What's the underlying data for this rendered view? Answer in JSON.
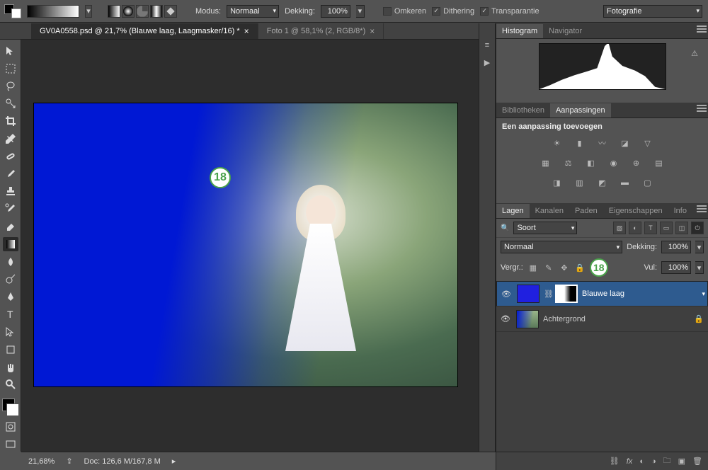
{
  "options_bar": {
    "modus_label": "Modus:",
    "modus_value": "Normaal",
    "dekking_label": "Dekking:",
    "dekking_value": "100%",
    "omkeren_label": "Omkeren",
    "omkeren_checked": false,
    "dithering_label": "Dithering",
    "dithering_checked": true,
    "transparantie_label": "Transparantie",
    "transparantie_checked": true,
    "workspace": "Fotografie"
  },
  "tabs": [
    {
      "label": "GV0A0558.psd @ 21,7% (Blauwe laag, Laagmasker/16) *",
      "active": true
    },
    {
      "label": "Foto 1 @ 58,1% (2, RGB/8*)",
      "active": false
    }
  ],
  "callout_a": "18",
  "callout_b": "18",
  "panels": {
    "histogram_tab": "Histogram",
    "navigator_tab": "Navigator",
    "bibliotheken_tab": "Bibliotheken",
    "aanpassingen_tab": "Aanpassingen",
    "aanpassingen_title": "Een aanpassing toevoegen",
    "layers": {
      "tabs": [
        "Lagen",
        "Kanalen",
        "Paden",
        "Eigenschappen",
        "Info"
      ],
      "filter_label": "Soort",
      "blend_mode": "Normaal",
      "opacity_label": "Dekking:",
      "opacity_value": "100%",
      "lock_label": "Vergr.:",
      "fill_label": "Vul:",
      "fill_value": "100%",
      "rows": [
        {
          "name": "Blauwe laag",
          "visible": true,
          "mask": true,
          "selected": true,
          "locked": false
        },
        {
          "name": "Achtergrond",
          "visible": true,
          "mask": false,
          "selected": false,
          "locked": true
        }
      ]
    }
  },
  "status": {
    "zoom": "21,68%",
    "doc": "Doc: 126,6 M/167,8 M"
  }
}
